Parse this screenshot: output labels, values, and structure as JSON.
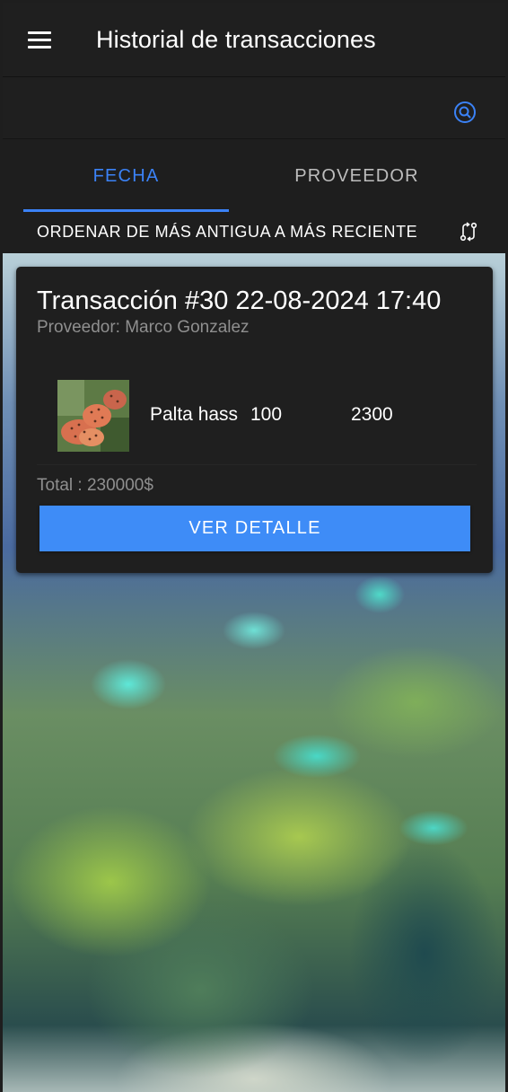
{
  "app_bar": {
    "title": "Historial de transacciones",
    "menu_icon": "menu-icon"
  },
  "search": {
    "icon": "search-icon",
    "icon_color": "#3b82f6"
  },
  "tabs": [
    {
      "label": "FECHA",
      "active": true
    },
    {
      "label": "PROVEEDOR",
      "active": false
    }
  ],
  "sort": {
    "label": "ORDENAR DE MÁS ANTIGUA A MÁS RECIENTE",
    "icon": "swap-icon"
  },
  "transactions": [
    {
      "title": "Transacción #30 22-08-2024 17:40",
      "provider": "Proveedor: Marco Gonzalez",
      "items": [
        {
          "name": "Palta hass",
          "quantity": "100",
          "price": "2300",
          "image": "fruit-thumbnail"
        }
      ],
      "total": "Total : 230000$",
      "detail_button": "VER DETALLE"
    }
  ],
  "colors": {
    "accent": "#3b82f6",
    "button": "#3e8cf7",
    "surface": "#1f1f1f",
    "muted_text": "#8f8f8f"
  }
}
